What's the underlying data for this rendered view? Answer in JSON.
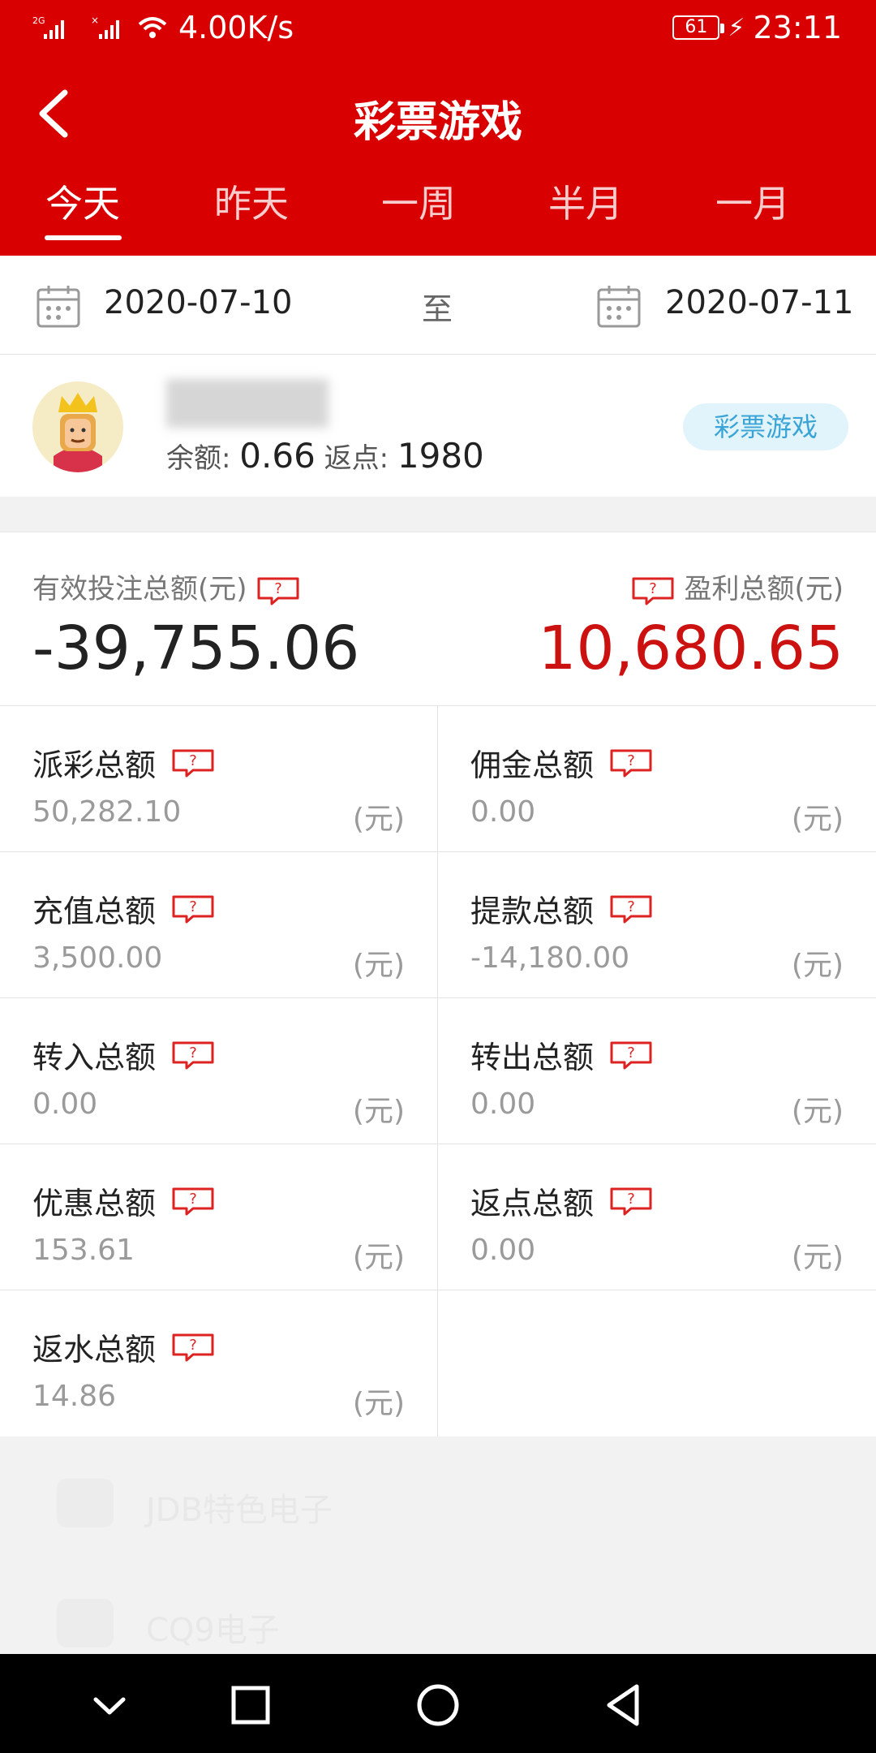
{
  "status_bar": {
    "network": "2G",
    "speed": "4.00K/s",
    "battery": "61",
    "time": "23:11"
  },
  "header": {
    "title": "彩票游戏"
  },
  "tabs": [
    {
      "label": "今天",
      "active": true
    },
    {
      "label": "昨天",
      "active": false
    },
    {
      "label": "一周",
      "active": false
    },
    {
      "label": "半月",
      "active": false
    },
    {
      "label": "一月",
      "active": false
    }
  ],
  "date_range": {
    "start": "2020-07-10",
    "separator": "至",
    "end": "2020-07-11"
  },
  "user": {
    "balance_label": "余额:",
    "balance_value": "0.66",
    "rebate_label": "返点:",
    "rebate_value": "1980",
    "category_pill": "彩票游戏"
  },
  "summary": {
    "bet_label": "有效投注总额(元)",
    "bet_value": "-39,755.06",
    "profit_label": "盈利总额(元)",
    "profit_value": "10,680.65"
  },
  "stats": [
    {
      "label": "派彩总额",
      "value": "50,282.10",
      "unit": "(元)"
    },
    {
      "label": "佣金总额",
      "value": "0.00",
      "unit": "(元)"
    },
    {
      "label": "充值总额",
      "value": "3,500.00",
      "unit": "(元)"
    },
    {
      "label": "提款总额",
      "value": "-14,180.00",
      "unit": "(元)"
    },
    {
      "label": "转入总额",
      "value": "0.00",
      "unit": "(元)"
    },
    {
      "label": "转出总额",
      "value": "0.00",
      "unit": "(元)"
    },
    {
      "label": "优惠总额",
      "value": "153.61",
      "unit": "(元)"
    },
    {
      "label": "返点总额",
      "value": "0.00",
      "unit": "(元)"
    },
    {
      "label": "返水总额",
      "value": "14.86",
      "unit": "(元)"
    }
  ],
  "background_items": [
    {
      "label": "JDB特色电子"
    },
    {
      "label": "CQ9电子"
    }
  ],
  "colors": {
    "brand_red": "#d80000",
    "profit_red": "#cc1111",
    "pill_text": "#3aa4d6",
    "pill_bg": "#e2f4fb"
  }
}
